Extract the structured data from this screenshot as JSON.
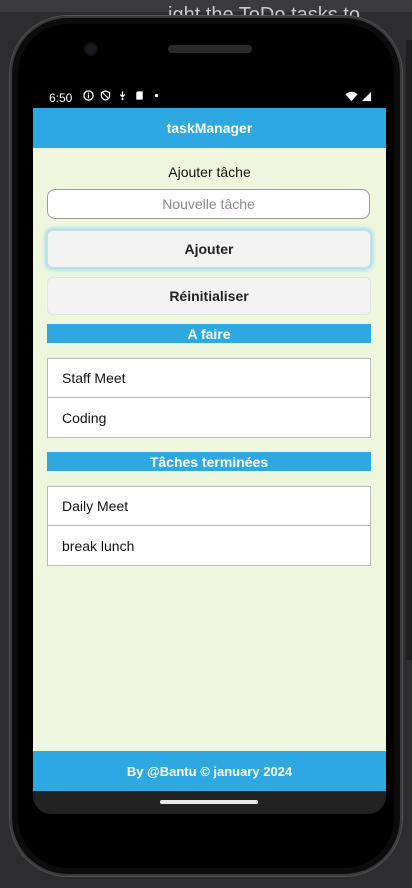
{
  "backdrop": {
    "text": "ight the ToDo tasks to"
  },
  "status": {
    "time": "6:50"
  },
  "app": {
    "title": "taskManager"
  },
  "form": {
    "heading": "Ajouter tâche",
    "input_placeholder": "Nouvelle tâche",
    "input_value": "",
    "add_label": "Ajouter",
    "reset_label": "Réinitialiser"
  },
  "todo": {
    "header": "A faire",
    "items": [
      {
        "label": "Staff Meet"
      },
      {
        "label": "Coding"
      }
    ]
  },
  "done": {
    "header": "Tâches terminées",
    "items": [
      {
        "label": "Daily Meet"
      },
      {
        "label": "break lunch"
      }
    ]
  },
  "footer": {
    "text": "By @Bantu © january 2024"
  },
  "colors": {
    "accent": "#2ea8e0",
    "background": "#eef7dd"
  }
}
